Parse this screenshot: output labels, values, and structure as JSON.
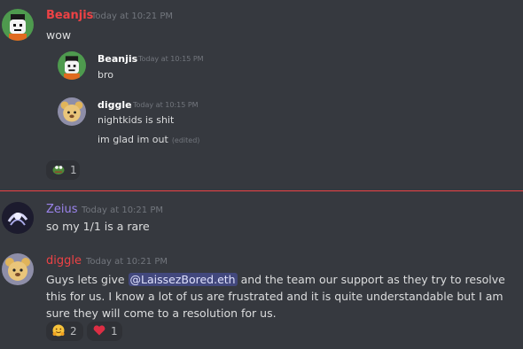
{
  "messages": [
    {
      "author": "Beanjis",
      "author_color": "#ed4245",
      "timestamp": "Today at 10:21 PM",
      "text": "wow",
      "embedded_quotes": [
        {
          "author": "Beanjis",
          "timestamp": "Today at 10:15 PM",
          "lines": [
            "bro"
          ]
        },
        {
          "author": "diggle",
          "timestamp": "Today at 10:15 PM",
          "lines": [
            "nightkids is shit",
            "im glad im out"
          ],
          "edited_label": "(edited)"
        }
      ],
      "reactions": [
        {
          "emoji": "pepe-emoji",
          "count": "1"
        }
      ]
    },
    {
      "author": "Zeius",
      "author_color": "#9b84ec",
      "timestamp": "Today at 10:21 PM",
      "text": "so my 1/1 is a rare"
    },
    {
      "author": "diggle",
      "author_color": "#ed4245",
      "timestamp": "Today at 10:21 PM",
      "text_before": "Guys lets give ",
      "mention": "@LaissezBored.eth",
      "text_after": " and the team our support as they try to resolve this for us. I know a lot of us are frustrated and it is quite understandable but I am sure they will come to a resolution for us.",
      "reactions": [
        {
          "emoji": "hugging-face-emoji",
          "count": "2"
        },
        {
          "emoji": "red-heart-emoji",
          "count": "1"
        }
      ]
    }
  ],
  "colors": {
    "background": "#36393f",
    "new_messages_divider": "#ed4245",
    "mention_bg": "#5865f2"
  }
}
